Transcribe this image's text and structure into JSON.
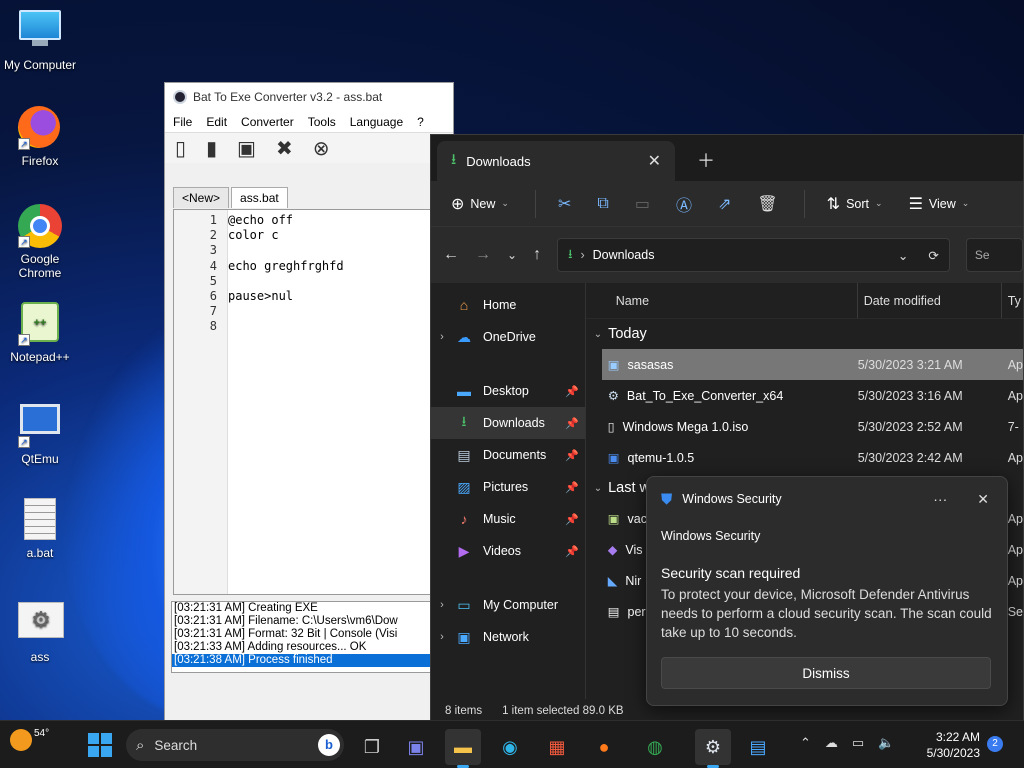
{
  "desktop": {
    "icons": [
      {
        "label": "My Computer",
        "icon": "monitor-icon"
      },
      {
        "label": "Firefox",
        "icon": "firefox-icon"
      },
      {
        "label": "Google Chrome",
        "icon": "chrome-icon"
      },
      {
        "label": "Notepad++",
        "icon": "notepadpp-icon"
      },
      {
        "label": "QtEmu",
        "icon": "qtemu-icon"
      },
      {
        "label": "a.bat",
        "icon": "batch-file-icon"
      },
      {
        "label": "ass",
        "icon": "gear-file-icon"
      }
    ]
  },
  "bte": {
    "title": "Bat To Exe Converter v3.2 - ass.bat",
    "menu": [
      "File",
      "Edit",
      "Converter",
      "Tools",
      "Language",
      "?"
    ],
    "tabs": [
      "<New>",
      "ass.bat"
    ],
    "line_numbers": [
      "1",
      "2",
      "3",
      "4",
      "5",
      "6",
      "7",
      "8"
    ],
    "code": [
      "@echo off",
      "color c",
      "",
      "echo  greghfrghfd",
      "",
      "pause>nul",
      "",
      ""
    ],
    "log": [
      "[03:21:31 AM] Creating EXE",
      "[03:21:31 AM] Filename: C:\\Users\\vm6\\Dow",
      "[03:21:31 AM] Format: 32 Bit | Console (Visi",
      "[03:21:33 AM] Adding resources... OK",
      "[03:21:38 AM] Process finished"
    ]
  },
  "explorer": {
    "tab_title": "Downloads",
    "commands": {
      "new": "New",
      "sort": "Sort",
      "view": "View"
    },
    "address": "Downloads",
    "search_placeholder": "Se",
    "nav": {
      "home": "Home",
      "onedrive": "OneDrive",
      "desktop": "Desktop",
      "downloads": "Downloads",
      "documents": "Documents",
      "pictures": "Pictures",
      "music": "Music",
      "videos": "Videos",
      "mycomputer": "My Computer",
      "network": "Network"
    },
    "columns": {
      "name": "Name",
      "date": "Date modified",
      "type": "Ty"
    },
    "groups": {
      "today": "Today",
      "lastweek": "Last week"
    },
    "today_files": [
      {
        "name": "sasasas",
        "date": "5/30/2023 3:21 AM",
        "type": "Ap"
      },
      {
        "name": "Bat_To_Exe_Converter_x64",
        "date": "5/30/2023 3:16 AM",
        "type": "Ap"
      },
      {
        "name": "Windows Mega 1.0.iso",
        "date": "5/30/2023 2:52 AM",
        "type": "7-"
      },
      {
        "name": "qtemu-1.0.5",
        "date": "5/30/2023 2:42 AM",
        "type": "Ap"
      }
    ],
    "lastweek_files": [
      {
        "name": "vac",
        "type": "Ap"
      },
      {
        "name": "Vis",
        "type": "Ap"
      },
      {
        "name": "Nir",
        "type": "Ap"
      },
      {
        "name": "per",
        "type": "Se"
      }
    ],
    "status": {
      "items": "8 items",
      "selected": "1 item selected  89.0 KB"
    }
  },
  "toast": {
    "header": "Windows Security",
    "app": "Windows Security",
    "title": "Security scan required",
    "body": "To protect your device, Microsoft Defender Antivirus needs to perform a cloud security scan. The scan could take up to 10 seconds.",
    "dismiss": "Dismiss"
  },
  "taskbar": {
    "temp": "54°",
    "search": "Search",
    "time": "3:22 AM",
    "date": "5/30/2023",
    "badge": "2"
  }
}
